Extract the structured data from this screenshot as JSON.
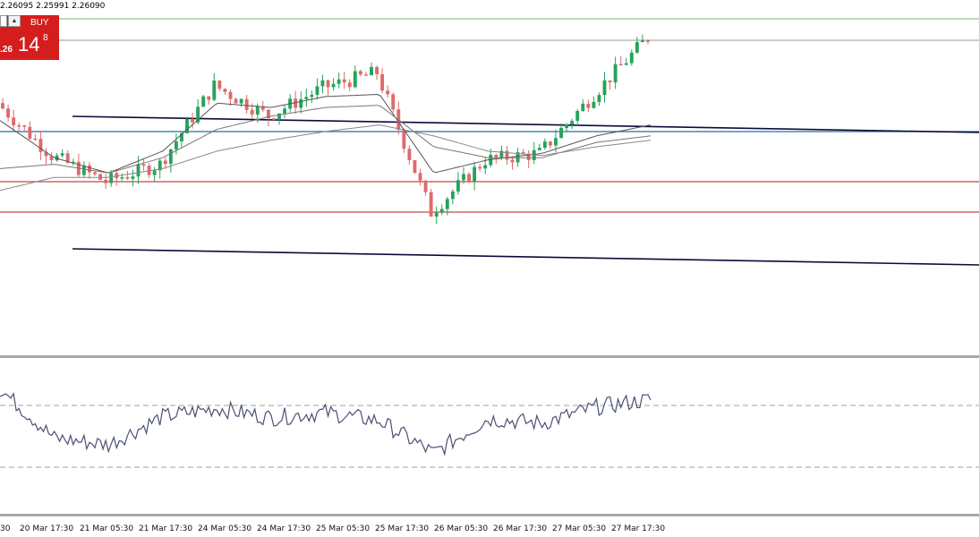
{
  "header": {
    "ohlc_text": "2.26095 2.25991 2.26090"
  },
  "trade_panel": {
    "scroll_up_icon": "arrow-up-icon",
    "buy_label": "BUY",
    "price_prefix": ".26",
    "price_big": "14",
    "price_sup": "8"
  },
  "colors": {
    "bull": "#26a35b",
    "bear": "#e06a6a",
    "trendline": "#0b0b3b",
    "blue_line": "#1f6fa8",
    "red_line": "#c84848",
    "green_line": "#6ac06a",
    "buy_bg": "#d41e1e"
  },
  "x_axis": {
    "labels": [
      "30",
      "20 Mar 17:30",
      "21 Mar 05:30",
      "21 Mar 17:30",
      "24 Mar 05:30",
      "24 Mar 17:30",
      "25 Mar 05:30",
      "25 Mar 17:30",
      "26 Mar 05:30",
      "26 Mar 17:30",
      "27 Mar 05:30",
      "27 Mar 17:30"
    ]
  },
  "chart_data": {
    "type": "line",
    "title": "",
    "subtitle": "",
    "xlabel": "",
    "ylabel": "",
    "grid": false,
    "x": [
      "30",
      "20 Mar 17:30",
      "21 Mar 05:30",
      "21 Mar 17:30",
      "24 Mar 05:30",
      "24 Mar 17:30",
      "25 Mar 05:30",
      "25 Mar 17:30",
      "26 Mar 05:30",
      "26 Mar 17:30",
      "27 Mar 05:30",
      "27 Mar 17:30",
      ""
    ],
    "series": [
      {
        "kind": "price_close",
        "values": [
          0.7,
          0.46,
          0.34,
          0.42,
          0.78,
          0.64,
          0.77,
          0.84,
          0.2,
          0.44,
          0.47,
          0.74,
          1.0
        ]
      },
      {
        "kind": "ma_fast",
        "values": [
          0.62,
          0.45,
          0.38,
          0.48,
          0.7,
          0.68,
          0.73,
          0.74,
          0.38,
          0.44,
          0.47,
          0.55,
          0.6
        ]
      },
      {
        "kind": "ma_medium",
        "values": [
          0.4,
          0.42,
          0.38,
          0.45,
          0.58,
          0.64,
          0.68,
          0.69,
          0.5,
          0.45,
          0.45,
          0.52,
          0.55
        ]
      },
      {
        "kind": "ma_slow",
        "values": [
          0.3,
          0.36,
          0.36,
          0.4,
          0.48,
          0.53,
          0.57,
          0.6,
          0.55,
          0.48,
          0.46,
          0.5,
          0.53
        ]
      }
    ],
    "oscillator": {
      "levels": [
        70,
        30
      ],
      "values": [
        88,
        42,
        36,
        62,
        70,
        61,
        66,
        58,
        28,
        60,
        56,
        71,
        78
      ]
    }
  }
}
